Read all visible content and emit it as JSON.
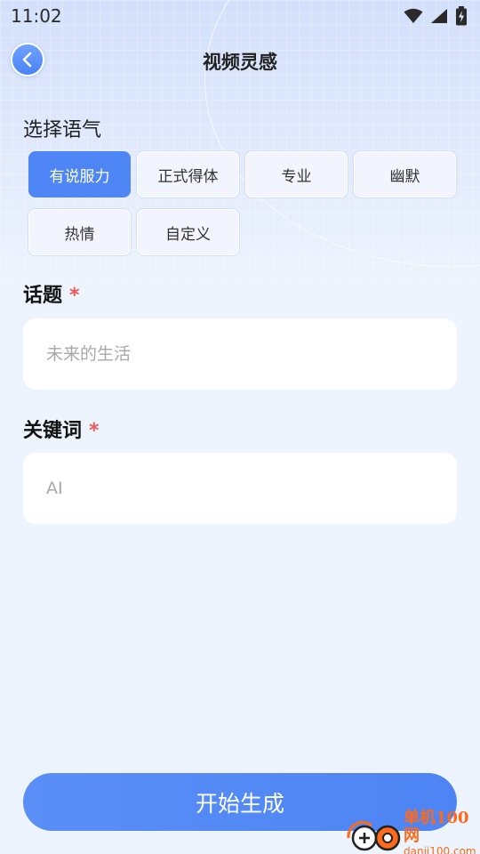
{
  "status_bar": {
    "time": "11:02"
  },
  "nav": {
    "title": "视频灵感"
  },
  "tone": {
    "label": "选择语气",
    "options": [
      "有说服力",
      "正式得体",
      "专业",
      "幽默",
      "热情",
      "自定义"
    ],
    "selected": "有说服力"
  },
  "topic": {
    "label": "话题",
    "required_mark": "*",
    "placeholder": "未来的生活"
  },
  "keywords": {
    "label": "关键词",
    "required_mark": "*",
    "placeholder": "AI"
  },
  "generate_button": {
    "label": "开始生成"
  },
  "watermark": {
    "name": "单机100网",
    "url": "danji100.com"
  },
  "colors": {
    "accent": "#4e86f5",
    "required": "#f05454",
    "watermark": "#ff6a1a"
  }
}
